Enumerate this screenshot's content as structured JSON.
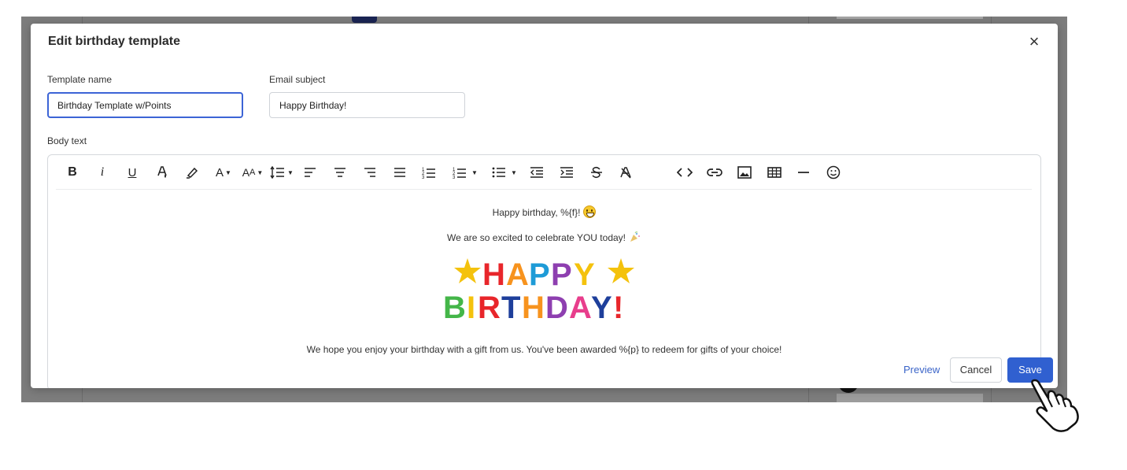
{
  "modal": {
    "title": "Edit birthday template",
    "close_icon": "close-icon"
  },
  "form": {
    "template_name_label": "Template name",
    "template_name_value": "Birthday Template w/Points",
    "email_subject_label": "Email subject",
    "email_subject_value": "Happy Birthday!",
    "body_text_label": "Body text"
  },
  "toolbar": {
    "items": [
      {
        "name": "bold-icon",
        "glyph": "B"
      },
      {
        "name": "italic-icon",
        "glyph": "i"
      },
      {
        "name": "underline-icon",
        "glyph": "U"
      },
      {
        "name": "text-color-icon",
        "glyph": "A"
      },
      {
        "name": "highlight-icon",
        "glyph": "✎"
      },
      {
        "name": "font-family-icon",
        "glyph": "A"
      },
      {
        "name": "font-size-icon",
        "glyph": "AA"
      },
      {
        "name": "line-height-icon",
        "glyph": "↕"
      },
      {
        "name": "align-left-icon"
      },
      {
        "name": "align-center-icon"
      },
      {
        "name": "align-right-icon"
      },
      {
        "name": "align-justify-icon"
      },
      {
        "name": "ordered-list-icon"
      },
      {
        "name": "ordered-list-options-icon"
      },
      {
        "name": "bullet-list-icon"
      },
      {
        "name": "outdent-icon"
      },
      {
        "name": "indent-icon"
      },
      {
        "name": "strikethrough-icon"
      },
      {
        "name": "clear-format-icon"
      },
      {
        "name": "code-icon"
      },
      {
        "name": "link-icon"
      },
      {
        "name": "image-icon"
      },
      {
        "name": "table-icon"
      },
      {
        "name": "horizontal-rule-icon"
      },
      {
        "name": "emoji-icon"
      }
    ]
  },
  "content": {
    "line1": "Happy birthday, %{f}!",
    "line2": "We are so excited to celebrate YOU today!",
    "banner_text_top": "HAPPY",
    "banner_text_bottom": "BIRTHDAY!",
    "line3": "We hope you enjoy your birthday with a gift from us. You've been awarded %{p} to redeem for gifts of your choice!"
  },
  "footer": {
    "preview_label": "Preview",
    "cancel_label": "Cancel",
    "save_label": "Save"
  },
  "colors": {
    "accent": "#3060d0",
    "link": "#3a64c8"
  }
}
